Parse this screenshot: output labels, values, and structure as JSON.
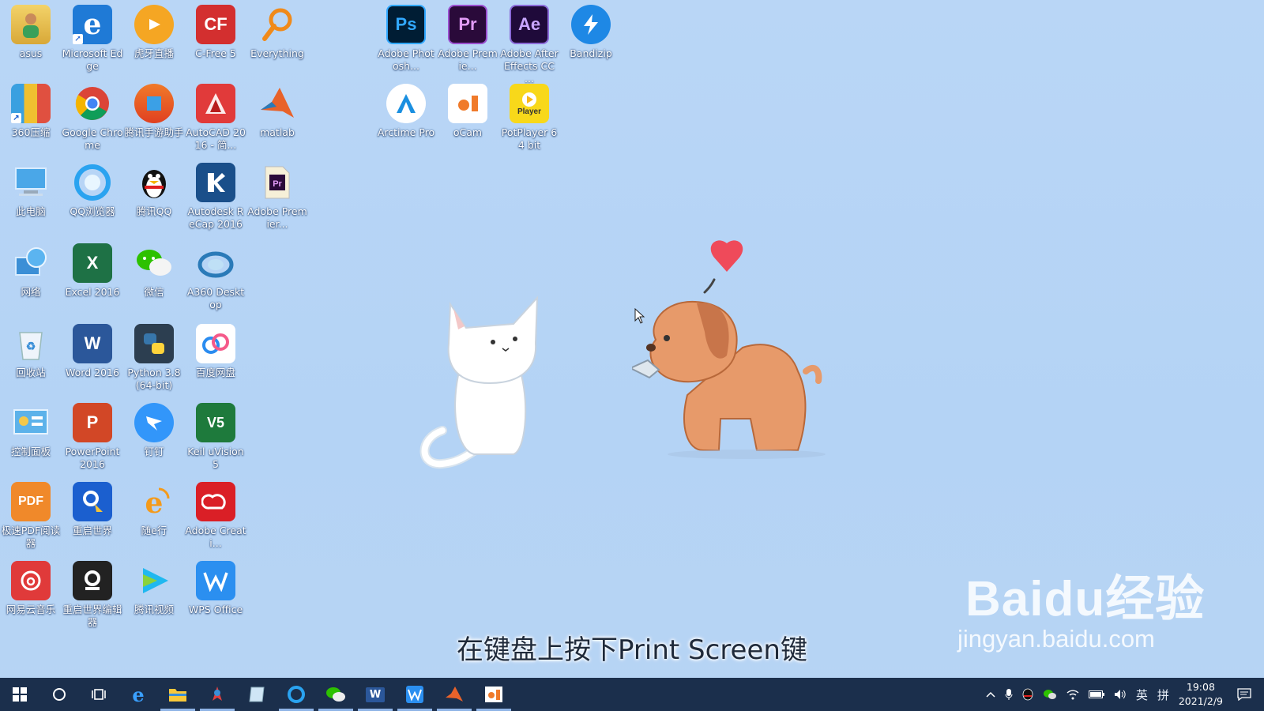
{
  "desktop_icons": [
    {
      "label": "asus"
    },
    {
      "label": "Microsoft Edge"
    },
    {
      "label": "虎牙直播"
    },
    {
      "label": "C-Free 5"
    },
    {
      "label": "Everything"
    },
    {
      "label": "Adobe Photosh..."
    },
    {
      "label": "Adobe Premie..."
    },
    {
      "label": "Adobe After Effects CC ..."
    },
    {
      "label": "Bandizip"
    },
    {
      "label": "360压缩"
    },
    {
      "label": "Google Chrome"
    },
    {
      "label": "腾讯手游助手"
    },
    {
      "label": "AutoCAD 2016 - 简..."
    },
    {
      "label": "matlab"
    },
    {
      "label": "Arctime Pro"
    },
    {
      "label": "oCam"
    },
    {
      "label": "PotPlayer 64 bit"
    },
    {
      "label": "此电脑"
    },
    {
      "label": "QQ浏览器"
    },
    {
      "label": "腾讯QQ"
    },
    {
      "label": "Autodesk ReCap 2016"
    },
    {
      "label": "Adobe Premier..."
    },
    {
      "label": "网络"
    },
    {
      "label": "Excel 2016"
    },
    {
      "label": "微信"
    },
    {
      "label": "A360 Desktop"
    },
    {
      "label": "回收站"
    },
    {
      "label": "Word 2016"
    },
    {
      "label": "Python 3.8 (64-bit)"
    },
    {
      "label": "百度网盘"
    },
    {
      "label": "控制面板"
    },
    {
      "label": "PowerPoint 2016"
    },
    {
      "label": "钉钉"
    },
    {
      "label": "Keil uVision5"
    },
    {
      "label": "极速PDF阅读器"
    },
    {
      "label": "重启世界"
    },
    {
      "label": "随e行"
    },
    {
      "label": "Adobe Creati..."
    },
    {
      "label": "网易云音乐"
    },
    {
      "label": "重启世界编辑器"
    },
    {
      "label": "腾讯视频"
    },
    {
      "label": "WPS Office"
    }
  ],
  "icon_glyphs": {
    "ps": "Ps",
    "pr": "Pr",
    "ae": "Ae",
    "cf": "CF",
    "pdf": "PDF",
    "w": "W",
    "x": "X",
    "p": "P",
    "keil": "V5",
    "pot": "Player"
  },
  "caption": "在键盘上按下Print Screen键",
  "watermark": {
    "brand": "Baidu经验",
    "url": "jingyan.baidu.com"
  },
  "tray": {
    "ime": "英",
    "ime2": "拼",
    "time": "19:08",
    "date": "2021/2/9"
  },
  "colors": {
    "taskbar": "#1b2f4c",
    "desktop": "#b7d4f4"
  }
}
